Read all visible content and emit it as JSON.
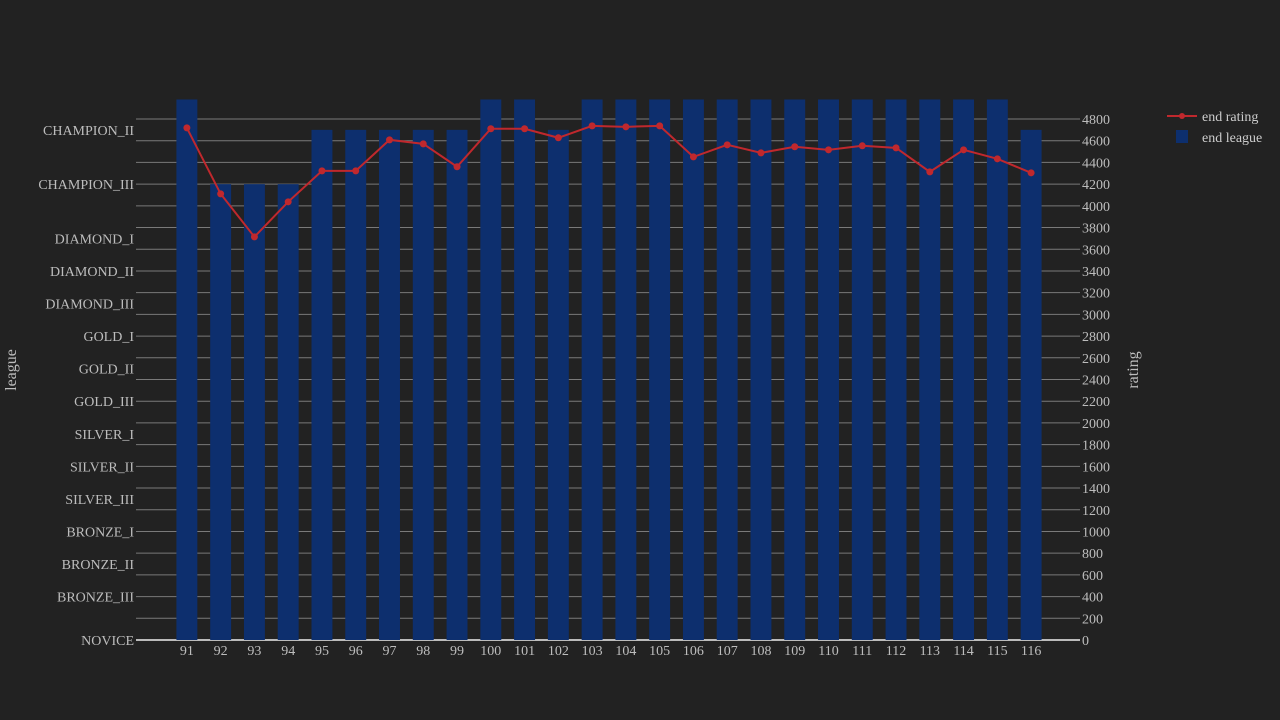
{
  "chart_data": {
    "type": "bar",
    "title": "",
    "xlabel": "",
    "ylabel_left": "league",
    "ylabel_right": "rating",
    "x": [
      91,
      92,
      93,
      94,
      95,
      96,
      97,
      98,
      99,
      100,
      101,
      102,
      103,
      104,
      105,
      106,
      107,
      108,
      109,
      110,
      111,
      112,
      113,
      114,
      115,
      116
    ],
    "x_tick_labels": [
      "91",
      "92",
      "93",
      "94",
      "95",
      "96",
      "97",
      "98",
      "99",
      "100",
      "101",
      "102",
      "103",
      "104",
      "105",
      "106",
      "107",
      "108",
      "109",
      "110",
      "111",
      "112",
      "113",
      "114",
      "115",
      "116"
    ],
    "rating_range": [
      0,
      5000
    ],
    "rating_ticks": [
      0,
      200,
      400,
      600,
      800,
      1000,
      1200,
      1400,
      1600,
      1800,
      2000,
      2200,
      2400,
      2600,
      2800,
      3000,
      3200,
      3400,
      3600,
      3800,
      4000,
      4200,
      4400,
      4600,
      4800
    ],
    "league_ticks": [
      {
        "label": "NOVICE",
        "value": 0
      },
      {
        "label": "BRONZE_III",
        "value": 400
      },
      {
        "label": "BRONZE_II",
        "value": 700
      },
      {
        "label": "BRONZE_I",
        "value": 1000
      },
      {
        "label": "SILVER_III",
        "value": 1300
      },
      {
        "label": "SILVER_II",
        "value": 1600
      },
      {
        "label": "SILVER_I",
        "value": 1900
      },
      {
        "label": "GOLD_III",
        "value": 2200
      },
      {
        "label": "GOLD_II",
        "value": 2500
      },
      {
        "label": "GOLD_I",
        "value": 2800
      },
      {
        "label": "DIAMOND_III",
        "value": 3100
      },
      {
        "label": "DIAMOND_II",
        "value": 3400
      },
      {
        "label": "DIAMOND_I",
        "value": 3700
      },
      {
        "label": "CHAMPION_III",
        "value": 4200
      },
      {
        "label": "CHAMPION_II",
        "value": 4700
      }
    ],
    "league_levels": {
      "CHAMPION_I": 4980,
      "CHAMPION_II": 4700,
      "CHAMPION_III": 4200
    },
    "series": [
      {
        "name": "end league",
        "type": "bar",
        "color": "#0d2f6e",
        "values": [
          "CHAMPION_I",
          "CHAMPION_III",
          "CHAMPION_III",
          "CHAMPION_III",
          "CHAMPION_II",
          "CHAMPION_II",
          "CHAMPION_II",
          "CHAMPION_II",
          "CHAMPION_II",
          "CHAMPION_I",
          "CHAMPION_I",
          "CHAMPION_II",
          "CHAMPION_I",
          "CHAMPION_I",
          "CHAMPION_I",
          "CHAMPION_I",
          "CHAMPION_I",
          "CHAMPION_I",
          "CHAMPION_I",
          "CHAMPION_I",
          "CHAMPION_I",
          "CHAMPION_I",
          "CHAMPION_I",
          "CHAMPION_I",
          "CHAMPION_I",
          "CHAMPION_II"
        ]
      },
      {
        "name": "end rating",
        "type": "line",
        "color": "#c0282d",
        "values": [
          4718,
          4110,
          3714,
          4037,
          4322,
          4322,
          4608,
          4571,
          4360,
          4710,
          4710,
          4627,
          4737,
          4728,
          4737,
          4451,
          4562,
          4488,
          4544,
          4516,
          4553,
          4534,
          4313,
          4516,
          4433,
          4304
        ]
      }
    ],
    "legend": {
      "position": "top-right",
      "entries": [
        "end rating",
        "end league"
      ]
    },
    "grid": true
  }
}
